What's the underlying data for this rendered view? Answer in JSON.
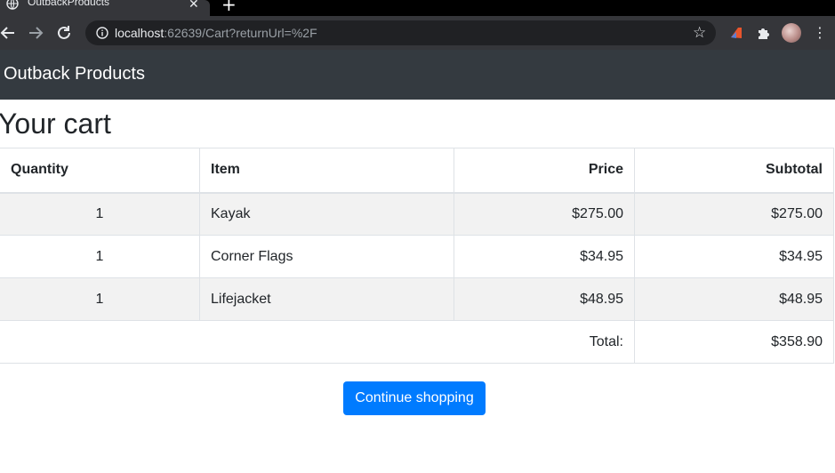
{
  "browser": {
    "tab_title": "OutbackProducts",
    "tab_close": "✕",
    "new_tab": "+",
    "url_host": "localhost",
    "url_rest": ":62639/Cart?returnUrl=%2F",
    "icons": [
      "globe-icon",
      "close-icon",
      "plus-icon",
      "back-arrow-icon",
      "forward-arrow-icon",
      "reload-icon",
      "info-icon",
      "star-icon",
      "extension-icon",
      "puzzle-icon",
      "avatar",
      "kebab-menu-icon"
    ]
  },
  "navbar": {
    "brand": "Outback Products",
    "bg_color": "#343a40"
  },
  "page": {
    "heading": "Your cart"
  },
  "cart": {
    "headers": {
      "quantity": "Quantity",
      "item": "Item",
      "price": "Price",
      "subtotal": "Subtotal"
    },
    "rows": [
      {
        "quantity": "1",
        "item": "Kayak",
        "price": "$275.00",
        "subtotal": "$275.00"
      },
      {
        "quantity": "1",
        "item": "Corner Flags",
        "price": "$34.95",
        "subtotal": "$34.95"
      },
      {
        "quantity": "1",
        "item": "Lifejacket",
        "price": "$48.95",
        "subtotal": "$48.95"
      }
    ],
    "total_label": "Total:",
    "total_value": "$358.90"
  },
  "actions": {
    "continue_label": "Continue shopping",
    "accent_color": "#007bff"
  }
}
